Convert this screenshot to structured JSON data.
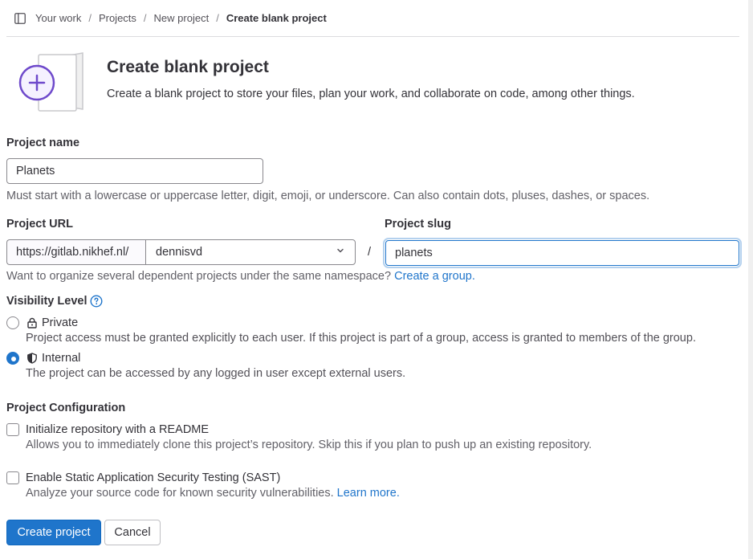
{
  "breadcrumbs": [
    "Your work",
    "Projects",
    "New project",
    "Create blank project"
  ],
  "header": {
    "title": "Create blank project",
    "description": "Create a blank project to store your files, plan your work, and collaborate on code, among other things."
  },
  "project_name": {
    "label": "Project name",
    "value": "Planets",
    "help": "Must start with a lowercase or uppercase letter, digit, emoji, or underscore. Can also contain dots, pluses, dashes, or spaces."
  },
  "project_url": {
    "label": "Project URL",
    "prefix": "https://gitlab.nikhef.nl/",
    "namespace": "dennisvd",
    "separator": "/"
  },
  "project_slug": {
    "label": "Project slug",
    "value": "planets"
  },
  "group_hint": {
    "text": "Want to organize several dependent projects under the same namespace?",
    "link": "Create a group."
  },
  "visibility": {
    "label": "Visibility Level",
    "options": [
      {
        "label": "Private",
        "icon": "lock-icon",
        "checked": false,
        "description": "Project access must be granted explicitly to each user. If this project is part of a group, access is granted to members of the group."
      },
      {
        "label": "Internal",
        "icon": "shield-icon",
        "checked": true,
        "description": "The project can be accessed by any logged in user except external users."
      }
    ]
  },
  "configuration": {
    "label": "Project Configuration",
    "options": [
      {
        "label": "Initialize repository with a README",
        "checked": false,
        "description": "Allows you to immediately clone this project’s repository. Skip this if you plan to push up an existing repository.",
        "link": ""
      },
      {
        "label": "Enable Static Application Security Testing (SAST)",
        "checked": false,
        "description": "Analyze your source code for known security vulnerabilities.",
        "link": "Learn more."
      }
    ]
  },
  "actions": {
    "create": "Create project",
    "cancel": "Cancel"
  },
  "colors": {
    "accent": "#1f75cb",
    "illustration": "#6e49cb"
  }
}
